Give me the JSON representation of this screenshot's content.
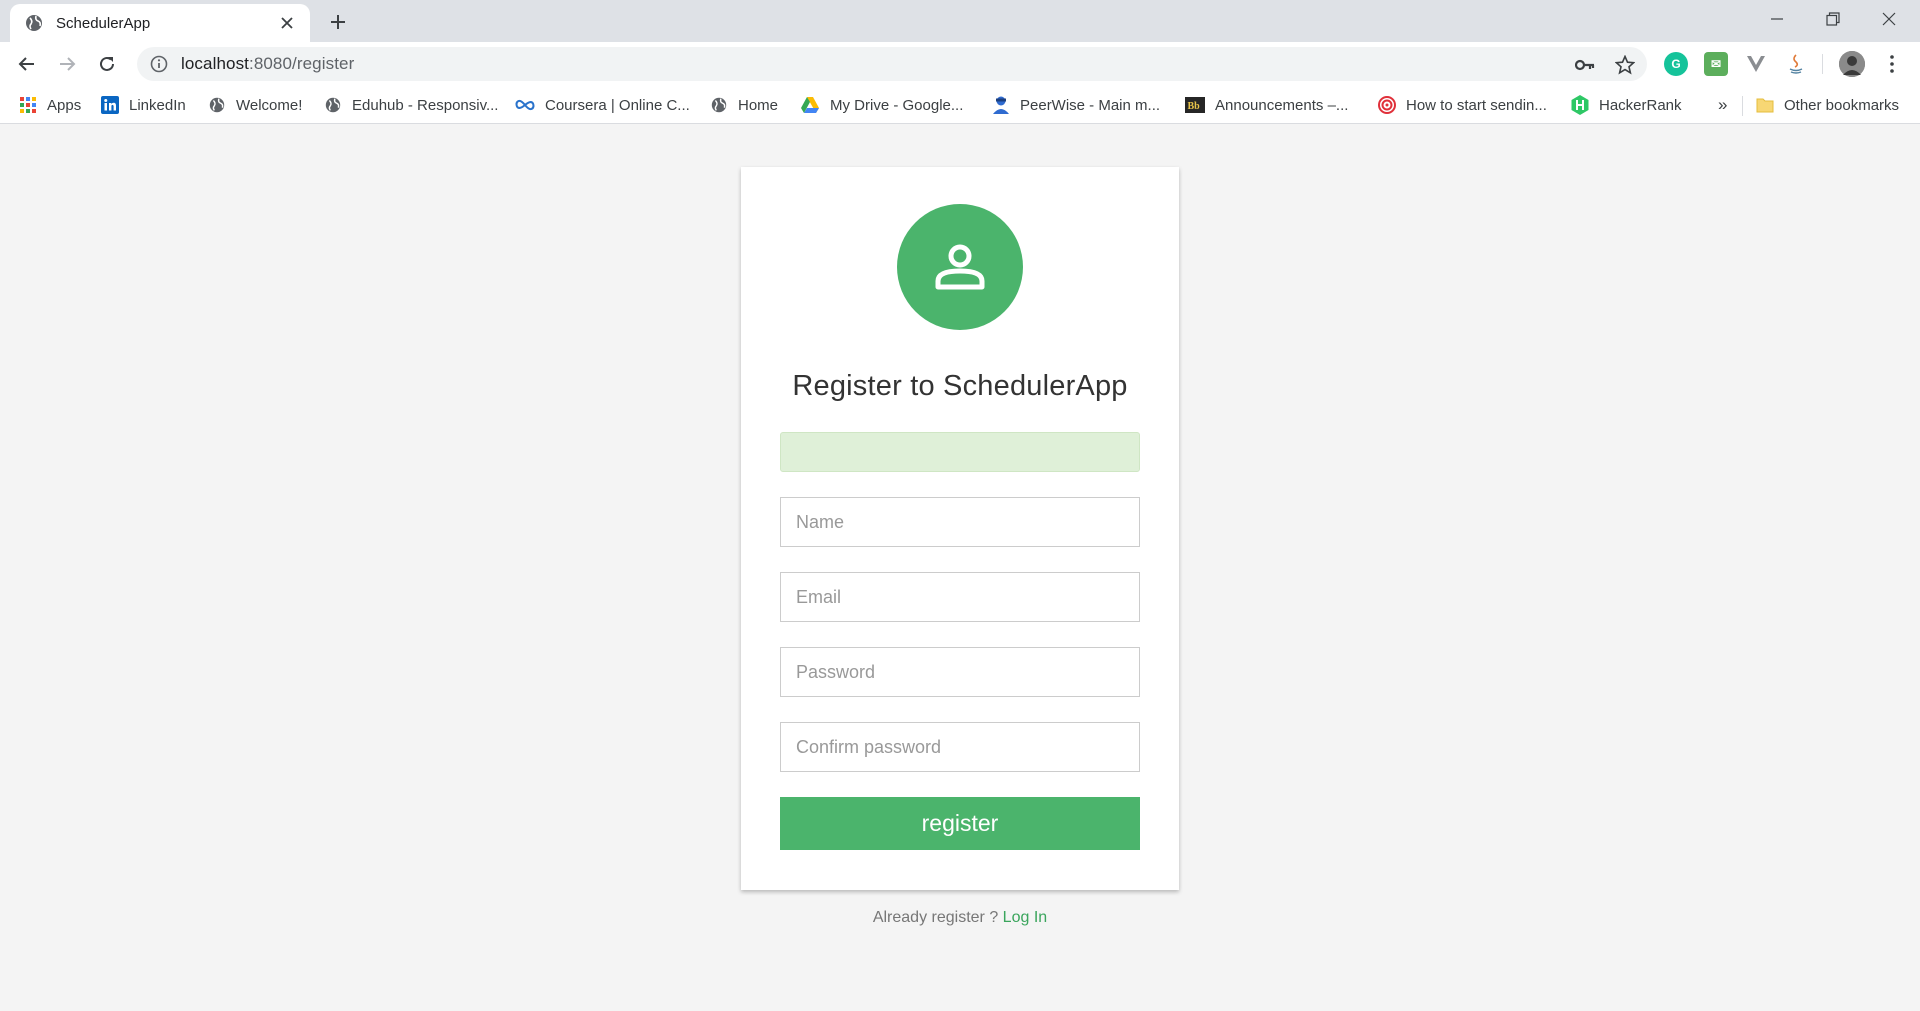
{
  "browser": {
    "tab": {
      "title": "SchedulerApp"
    },
    "url": {
      "host": "localhost",
      "path": ":8080/register"
    },
    "bookmarks": [
      {
        "label": "Apps",
        "icon": "apps-grid-icon"
      },
      {
        "label": "LinkedIn",
        "icon": "linkedin-icon"
      },
      {
        "label": "Welcome!",
        "icon": "globe-icon"
      },
      {
        "label": "Eduhub - Responsiv...",
        "icon": "globe-icon"
      },
      {
        "label": "Coursera | Online C...",
        "icon": "coursera-icon"
      },
      {
        "label": "Home",
        "icon": "globe-icon"
      },
      {
        "label": "My Drive - Google...",
        "icon": "google-drive-icon"
      },
      {
        "label": "PeerWise - Main m...",
        "icon": "peerwise-icon"
      },
      {
        "label": "Announcements –...",
        "icon": "blackboard-icon"
      },
      {
        "label": "How to start sendin...",
        "icon": "target-icon"
      },
      {
        "label": "HackerRank",
        "icon": "hackerrank-icon"
      }
    ],
    "overflow_label": "»",
    "other_bookmarks": "Other bookmarks"
  },
  "page": {
    "title": "Register to SchedulerApp",
    "fields": {
      "name_placeholder": "Name",
      "email_placeholder": "Email",
      "password_placeholder": "Password",
      "confirm_placeholder": "Confirm password"
    },
    "submit_label": "register",
    "footer_text": "Already register ? ",
    "login_link": "Log In"
  },
  "colors": {
    "accent": "#4bb46c",
    "alert_bg": "#dff0d8",
    "page_bg": "#f4f4f4"
  }
}
